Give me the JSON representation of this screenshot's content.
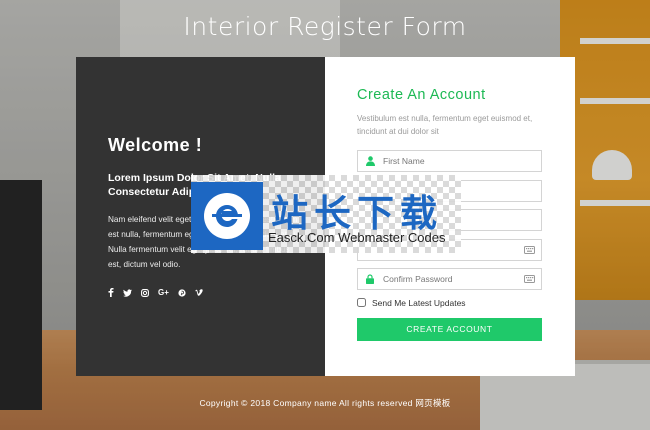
{
  "page": {
    "title": "Interior Register Form"
  },
  "left_panel": {
    "welcome": "Welcome !",
    "heading": "Lorem Ipsum Dolor Sit Amet, Nulla Consectetur Adipiscing",
    "body": "Nam eleifend velit eget erat imperdiet, at Vestibulum est nulla, fermentum eget euismod et, tincidunt at dui. Nulla fermentum velit eget justo vel, rutrum finibus est, dictum vel odio.",
    "socials": [
      {
        "name": "facebook-icon",
        "label": "f"
      },
      {
        "name": "twitter-icon",
        "label": "t"
      },
      {
        "name": "instagram-icon",
        "label": "ig"
      },
      {
        "name": "google-plus-icon",
        "label": "G+"
      },
      {
        "name": "pinterest-icon",
        "label": "p"
      },
      {
        "name": "vimeo-icon",
        "label": "V"
      }
    ]
  },
  "form": {
    "title": "Create An Account",
    "description": "Vestibulum est nulla, fermentum eget euismod et, tincidunt at dui dolor sit",
    "fields": {
      "first_name": {
        "placeholder": "First Name",
        "value": ""
      },
      "last_name": {
        "placeholder": "",
        "value": ""
      },
      "email": {
        "placeholder": "",
        "value": ""
      },
      "password": {
        "placeholder": "",
        "value": ""
      },
      "confirm_password": {
        "placeholder": "Confirm Password",
        "value": ""
      }
    },
    "checkbox_label": "Send Me Latest Updates",
    "submit_label": "CREATE ACCOUNT"
  },
  "watermark": {
    "cn": "站长下载",
    "en": "Easck.Com Webmaster Codes"
  },
  "footer": {
    "text": "Copyright © 2018 Company name All rights reserved 网页模板"
  },
  "colors": {
    "accent": "#1fc96a",
    "panel_dark": "#333333",
    "watermark_blue": "#1d67c2"
  }
}
